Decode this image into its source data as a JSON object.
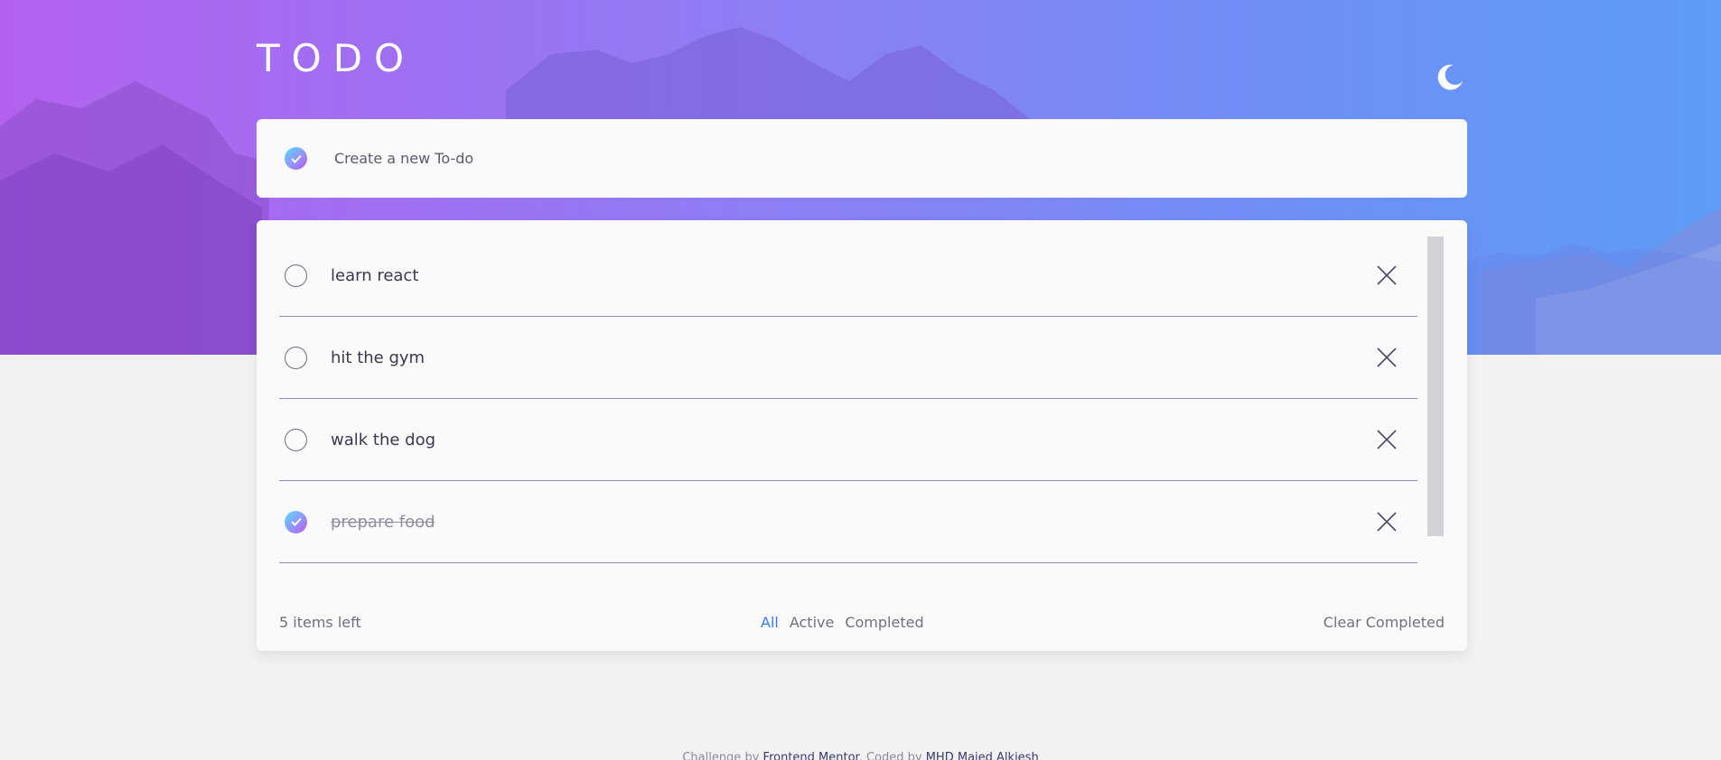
{
  "app": {
    "title": "TODO",
    "theme_icon": "moon-icon"
  },
  "colors": {
    "gradient_start": "#57ddff",
    "gradient_end": "#c058f3",
    "active_filter": "#3a7bfd",
    "card_bg": "#fafafa",
    "page_bg": "#f2f2f2"
  },
  "new_todo": {
    "placeholder": "Create a new To-do",
    "check_icon": "check-icon"
  },
  "todos": [
    {
      "text": "learn react",
      "completed": false
    },
    {
      "text": "hit the gym",
      "completed": false
    },
    {
      "text": "walk the dog",
      "completed": false
    },
    {
      "text": "prepare food",
      "completed": true
    }
  ],
  "footer": {
    "items_left": "5 items left",
    "filters": [
      "All",
      "Active",
      "Completed"
    ],
    "active_filter": "All",
    "clear_label": "Clear Completed"
  },
  "credit": {
    "prefix": "Challenge by ",
    "challenge_link": "Frontend Mentor",
    "middle": ". Coded by ",
    "author_link": "MHD Majed Alkiesh"
  }
}
